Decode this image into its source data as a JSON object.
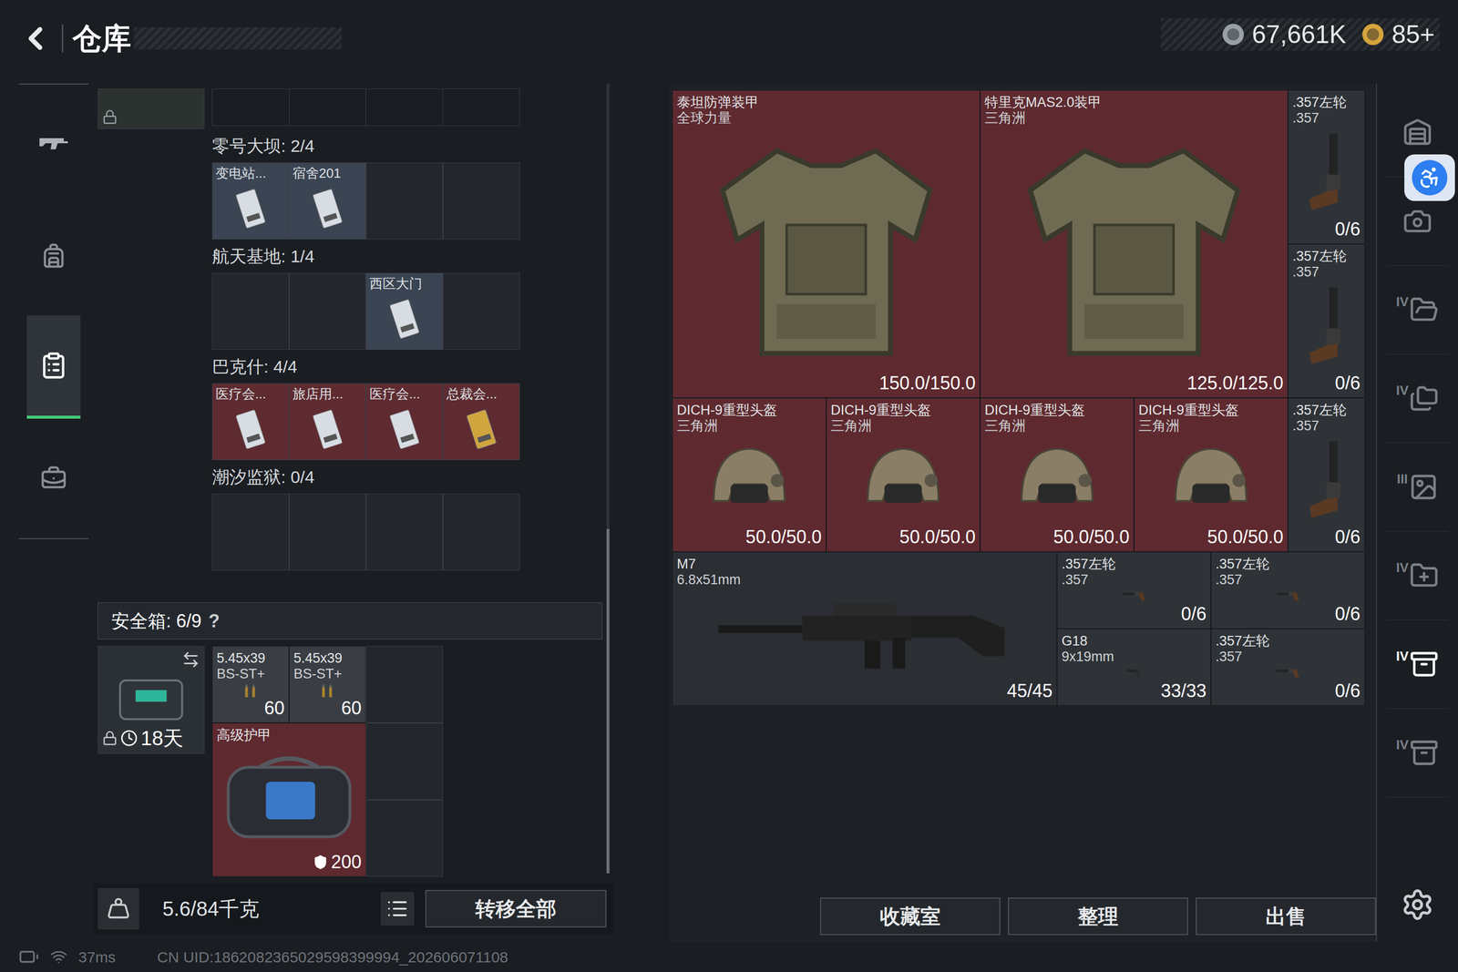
{
  "header": {
    "title": "仓库",
    "currencies": [
      {
        "amount": "67,661K",
        "color": "#9aa0a8"
      },
      {
        "amount": "85+",
        "color": "#d6a43c"
      }
    ]
  },
  "nav": [
    {
      "kind": "weapon",
      "selected": false
    },
    {
      "kind": "backpack",
      "selected": false
    },
    {
      "kind": "stash",
      "selected": true
    },
    {
      "kind": "briefcase",
      "selected": false
    }
  ],
  "key_room": {
    "top_item": {
      "locked": true
    },
    "sections": [
      {
        "title": "零号大坝: 2/4",
        "slots": [
          {
            "name": "变电站...",
            "filled": true,
            "color": "#3b4452",
            "card_color": "#d8dde4"
          },
          {
            "name": "宿舍201",
            "filled": true,
            "color": "#3b4452",
            "card_color": "#d8dde4"
          },
          {
            "name": "",
            "filled": false,
            "color": "#23272d",
            "card_color": "#23272d"
          },
          {
            "name": "",
            "filled": false,
            "color": "#23272d",
            "card_color": "#23272d"
          }
        ]
      },
      {
        "title": "航天基地: 1/4",
        "slots": [
          {
            "name": "",
            "filled": false,
            "color": "#23272d",
            "card_color": "#23272d"
          },
          {
            "name": "",
            "filled": false,
            "color": "#23272d",
            "card_color": "#23272d"
          },
          {
            "name": "西区大门",
            "filled": true,
            "color": "#3b4452",
            "card_color": "#d8dde4"
          },
          {
            "name": "",
            "filled": false,
            "color": "#23272d",
            "card_color": "#23272d"
          }
        ]
      },
      {
        "title": "巴克什: 4/4",
        "slots": [
          {
            "name": "医疗会...",
            "filled": true,
            "color": "#5e2b31",
            "card_color": "#d8dde4"
          },
          {
            "name": "旅店用...",
            "filled": true,
            "color": "#5e2b31",
            "card_color": "#d8dde4"
          },
          {
            "name": "医疗会...",
            "filled": true,
            "color": "#5e2b31",
            "card_color": "#d8dde4"
          },
          {
            "name": "总裁会...",
            "filled": true,
            "color": "#5e2b31",
            "card_color": "#d1a53e"
          }
        ]
      },
      {
        "title": "潮汐监狱: 0/4",
        "slots": [
          {
            "name": "",
            "filled": false,
            "color": "#23272d",
            "card_color": "#23272d"
          },
          {
            "name": "",
            "filled": false,
            "color": "#23272d",
            "card_color": "#23272d"
          },
          {
            "name": "",
            "filled": false,
            "color": "#23272d",
            "card_color": "#23272d"
          },
          {
            "name": "",
            "filled": false,
            "color": "#23272d",
            "card_color": "#23272d"
          }
        ]
      }
    ]
  },
  "safe_box": {
    "title": "安全箱: 6/9",
    "help": "?",
    "case": {
      "locked": true,
      "time": "18天"
    },
    "items": [
      {
        "name": "5.45x39",
        "sub": "BS-ST+",
        "count": "60",
        "kind": "ammo",
        "color": "#3a3e44"
      },
      {
        "name": "5.45x39",
        "sub": "BS-ST+",
        "count": "60",
        "kind": "ammo",
        "color": "#3a3e44"
      },
      {
        "name": "高级护甲",
        "sub": "",
        "count": "200",
        "kind": "bag",
        "color": "#5e2a30"
      }
    ]
  },
  "capacity": {
    "reading": "5.6/84千克"
  },
  "transfer_button": "转移全部",
  "stash": {
    "items": [
      {
        "name": "泰坦防弹装甲",
        "sub": "全球力量",
        "count": "150.0/150.0",
        "kind": "armor",
        "color": "#5e2a30"
      },
      {
        "name": "特里克MAS2.0装甲",
        "sub": "三角洲",
        "count": "125.0/125.0",
        "kind": "armor",
        "color": "#5e2a30"
      },
      {
        "name": ".357左轮",
        "sub": ".357",
        "count": "0/6",
        "kind": "revolver",
        "color": "#2f3338"
      },
      {
        "name": ".357左轮",
        "sub": ".357",
        "count": "0/6",
        "kind": "revolver",
        "color": "#2f3338"
      },
      {
        "name": "DICH-9重型头盔",
        "sub": "三角洲",
        "count": "50.0/50.0",
        "kind": "helmet",
        "color": "#5e2a30"
      },
      {
        "name": "DICH-9重型头盔",
        "sub": "三角洲",
        "count": "50.0/50.0",
        "kind": "helmet",
        "color": "#5e2a30"
      },
      {
        "name": "DICH-9重型头盔",
        "sub": "三角洲",
        "count": "50.0/50.0",
        "kind": "helmet",
        "color": "#5e2a30"
      },
      {
        "name": "DICH-9重型头盔",
        "sub": "三角洲",
        "count": "50.0/50.0",
        "kind": "helmet",
        "color": "#5e2a30"
      },
      {
        "name": ".357左轮",
        "sub": ".357",
        "count": "0/6",
        "kind": "revolver",
        "color": "#2f3338"
      },
      {
        "name": "M7",
        "sub": "6.8x51mm",
        "count": "45/45",
        "kind": "rifle",
        "color": "#2b2e33"
      },
      {
        "name": ".357左轮",
        "sub": ".357",
        "count": "0/6",
        "kind": "revolver",
        "color": "#2f3338"
      },
      {
        "name": ".357左轮",
        "sub": ".357",
        "count": "0/6",
        "kind": "revolver",
        "color": "#2f3338"
      },
      {
        "name": "G18",
        "sub": "9x19mm",
        "count": "33/33",
        "kind": "pistol",
        "color": "#2f3338"
      },
      {
        "name": ".357左轮",
        "sub": ".357",
        "count": "0/6",
        "kind": "revolver",
        "color": "#2f3338"
      }
    ]
  },
  "actions": [
    "收藏室",
    "整理",
    "出售"
  ],
  "tools": [
    {
      "label": "",
      "selected": false
    },
    {
      "label": "",
      "selected": false
    },
    {
      "label": "IV",
      "selected": false
    },
    {
      "label": "IV",
      "selected": false
    },
    {
      "label": "III",
      "selected": false
    },
    {
      "label": "IV",
      "selected": false
    },
    {
      "label": "IV",
      "selected": true
    },
    {
      "label": "IV",
      "selected": false
    }
  ],
  "status": {
    "ping": "37ms",
    "uid": "CN UID:1862082365029598399994_202606071108"
  }
}
